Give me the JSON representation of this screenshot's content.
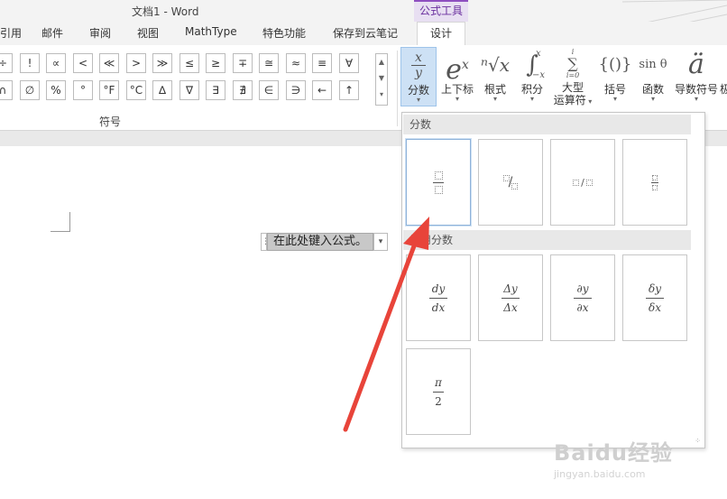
{
  "window": {
    "title": "文档1 - Word"
  },
  "context_tab": {
    "label": "公式工具"
  },
  "tabs": [
    {
      "label": "引用"
    },
    {
      "label": "邮件"
    },
    {
      "label": "审阅"
    },
    {
      "label": "视图"
    },
    {
      "label": "MathType"
    },
    {
      "label": "特色功能"
    },
    {
      "label": "保存到云笔记"
    },
    {
      "label": "设计"
    }
  ],
  "symbols": {
    "row1": [
      "÷",
      "!",
      "∝",
      "<",
      "≪",
      ">",
      "≫",
      "≤",
      "≥",
      "∓",
      "≅",
      "≈",
      "≡",
      "∀"
    ],
    "row2": [
      "∩",
      "∅",
      "%",
      "°",
      "°F",
      "°C",
      "∆",
      "∇",
      "∃",
      "∄",
      "∈",
      "∋",
      "←",
      "↑"
    ],
    "group_label": "符号"
  },
  "ribbon": {
    "buttons": [
      {
        "id": "fraction",
        "label": "分数",
        "glyph_top": "x",
        "glyph_bottom": "y",
        "selected": true
      },
      {
        "id": "script",
        "label": "上下标",
        "glyph": "e",
        "glyph_sup": "x"
      },
      {
        "id": "radical",
        "label": "根式",
        "glyph": "ⁿ√x"
      },
      {
        "id": "integral",
        "label": "积分",
        "glyph": "∫",
        "glyph_sup": "x",
        "glyph_sub": "−x"
      },
      {
        "id": "large-operator",
        "label": "大型",
        "label2": "运算符",
        "glyph": "∑",
        "glyph_sup": "i",
        "glyph_sub": "i=0"
      },
      {
        "id": "bracket",
        "label": "括号",
        "glyph": "{()}"
      },
      {
        "id": "function",
        "label": "函数",
        "glyph": "sin θ"
      },
      {
        "id": "accent",
        "label": "导数符号",
        "glyph": "ä"
      },
      {
        "id": "limit",
        "label": "极"
      }
    ]
  },
  "document": {
    "equation_placeholder": "在此处键入公式。"
  },
  "gallery": {
    "section1": {
      "title": "分数",
      "items": [
        {
          "name": "stacked-fraction"
        },
        {
          "name": "skewed-fraction"
        },
        {
          "name": "linear-fraction"
        },
        {
          "name": "small-fraction"
        }
      ]
    },
    "section2": {
      "title": "常用分数",
      "items": [
        {
          "name": "dy-dx",
          "num": "dy",
          "den": "dx"
        },
        {
          "name": "delta-y-delta-x",
          "num": "Δy",
          "den": "Δx"
        },
        {
          "name": "partial-y-partial-x",
          "num": "∂y",
          "den": "∂x"
        },
        {
          "name": "small-delta-y-delta-x",
          "num": "δy",
          "den": "δx"
        },
        {
          "name": "pi-over-2",
          "num": "π",
          "den": "2"
        }
      ]
    }
  },
  "watermark": {
    "logo": "Baidu经验",
    "url": "jingyan.baidu.com"
  },
  "colors": {
    "accent": "#8e4fbf",
    "arrow": "#e8443a",
    "selected": "#cde1f5"
  }
}
